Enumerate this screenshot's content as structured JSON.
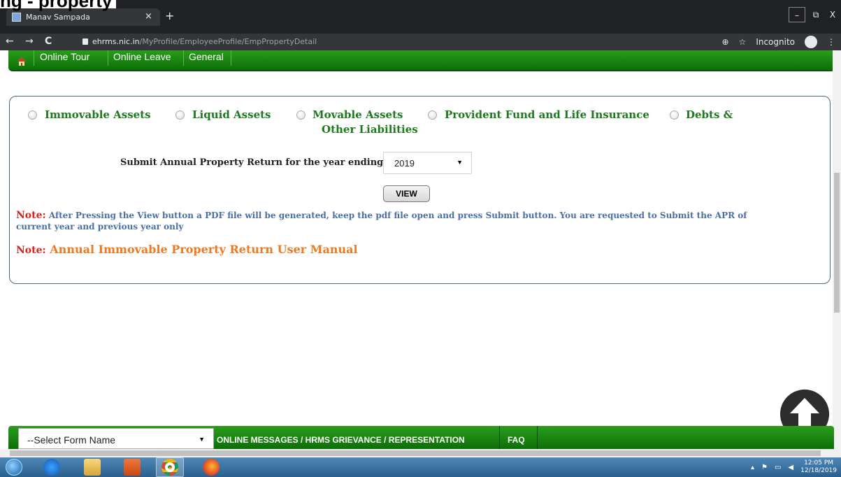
{
  "overlay_heading": "ng - property",
  "browser": {
    "tab_title": "Manav Sampada",
    "tab_close": "×",
    "new_tab": "+",
    "url_host": "ehrms.nic.in",
    "url_path": "/MyProfile/EmployeeProfile/EmpPropertyDetail",
    "incognito_label": "Incognito",
    "win_minimize": "–",
    "win_restore": "⧉",
    "win_close": "X",
    "back": "←",
    "forward": "→",
    "reload": "C",
    "zoom": "⊕",
    "star": "☆",
    "menu": "⋮"
  },
  "topnav": {
    "links": [
      "Online Tour",
      "Online Leave",
      "General"
    ]
  },
  "assets": {
    "options": [
      {
        "label": "Immovable Assets"
      },
      {
        "label": "Liquid Assets"
      },
      {
        "label": "Movable Assets",
        "label2": "Other Liabilities"
      },
      {
        "label": "Provident Fund and Life Insurance"
      },
      {
        "label": "Debts &"
      }
    ]
  },
  "apr": {
    "label": "Submit Annual Property Return for the year ending",
    "year": "2019",
    "arrow": "▼",
    "view_button": "VIEW"
  },
  "notes": {
    "prefix": "Note:",
    "note1_text": "After Pressing the View button a PDF file will be generated, keep the pdf file open and press Submit button. You are requested to Submit the APR of current year and previous year only",
    "note2_link": "Annual Immovable Property Return User Manual"
  },
  "footer": {
    "select_form": "--Select Form Name",
    "arrow": "▼",
    "messages_link": "ONLINE MESSAGES / HRMS GRIEVANCE / REPRESENTATION",
    "faq_link": "FAQ"
  },
  "taskbar": {
    "time": "12:05 PM",
    "date": "12/18/2019"
  },
  "colors": {
    "green_nav": "#1a8a12",
    "asset_label": "#1d7a1d",
    "note_red": "#e0201b",
    "note_blue": "#4a6fa5",
    "manual_orange": "#f07820"
  }
}
